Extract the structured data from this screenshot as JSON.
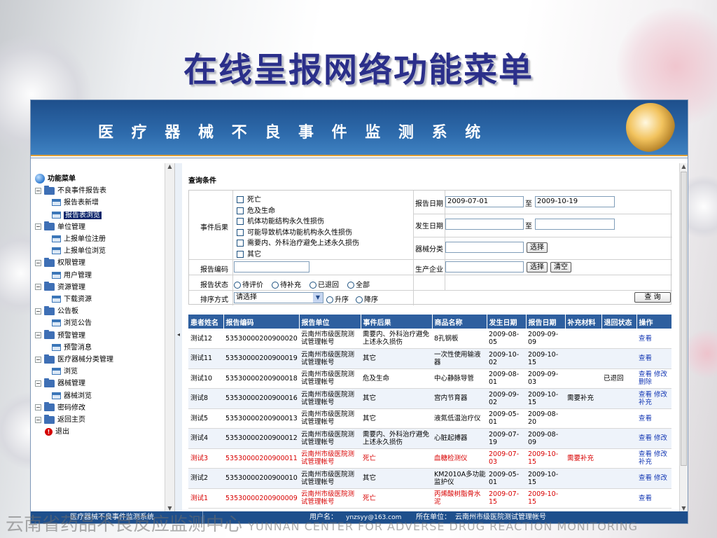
{
  "slide_title": "在线呈报网络功能菜单",
  "watermark": {
    "cn": "云南省药品不良反应监测中心",
    "en": "YUNNAN CENTER FOR ADVERSE DRUG REACTION MONITORING"
  },
  "banner_title": "医 疗 器 械 不 良 事 件 监 测 系 统",
  "tree": {
    "root": "功能菜单",
    "groups": [
      {
        "label": "不良事件报告表",
        "items": [
          "报告表新增",
          "报告表浏览"
        ]
      },
      {
        "label": "单位管理",
        "items": [
          "上报单位注册",
          "上报单位浏览"
        ]
      },
      {
        "label": "权限管理",
        "items": [
          "用户管理"
        ]
      },
      {
        "label": "资源管理",
        "items": [
          "下载资源"
        ]
      },
      {
        "label": "公告板",
        "items": [
          "浏览公告"
        ]
      },
      {
        "label": "预警管理",
        "items": [
          "预警消息"
        ]
      },
      {
        "label": "医疗器械分类管理",
        "items": [
          "浏览"
        ]
      },
      {
        "label": "器械管理",
        "items": [
          "器械浏览"
        ]
      },
      {
        "label": "密码修改",
        "items": []
      },
      {
        "label": "返回主页",
        "items": []
      }
    ],
    "exit": "退出",
    "selected": "报告表浏览",
    "expand_glyph": "−",
    "collapse_arrow": "◂",
    "scroll_up": "▲",
    "scroll_down": "▼"
  },
  "query": {
    "title": "查询条件",
    "event_result_label": "事件后果",
    "event_results": [
      "死亡",
      "危及生命",
      "机体功能结构永久性损伤",
      "可能导致机体功能机构永久性损伤",
      "需要内、外科治疗避免上述永久损伤",
      "其它"
    ],
    "report_code_label": "报告编码",
    "report_status_label": "报告状态",
    "report_statuses": [
      "待评价",
      "待补充",
      "已退回",
      "全部"
    ],
    "sort_label": "排序方式",
    "sort_value": "请选择",
    "sort_orders": [
      "升序",
      "降序"
    ],
    "report_date_label": "报告日期",
    "report_date_from": "2009-07-01",
    "report_date_to": "2009-10-19",
    "to_label": "至",
    "occur_date_label": "发生日期",
    "device_class_label": "器械分类",
    "manufacturer_label": "生产企业",
    "select_button": "选择",
    "clear_button": "清空",
    "search_button": "查 询",
    "dropdown_glyph": "▼"
  },
  "table": {
    "headers": [
      "患者姓名",
      "报告编码",
      "报告单位",
      "事件后果",
      "商品名称",
      "发生日期",
      "报告日期",
      "补充材料",
      "退回状态",
      "操作"
    ],
    "rows": [
      {
        "name": "测试12",
        "code": "53530000200900020",
        "unit": "云南州市级医院测试管理帐号",
        "result": "需要内、外科治疗避免上述永久损伤",
        "product": "8孔钢板",
        "occur": "2009-08-05",
        "report": "2009-09-09",
        "supp": "",
        "ret": "",
        "ops": "查看",
        "red": false
      },
      {
        "name": "测试11",
        "code": "53530000200900019",
        "unit": "云南州市级医院测试管理帐号",
        "result": "其它",
        "product": "一次性使用输液器",
        "occur": "2009-10-02",
        "report": "2009-10-15",
        "supp": "",
        "ret": "",
        "ops": "查看",
        "red": false
      },
      {
        "name": "测试10",
        "code": "53530000200900018",
        "unit": "云南州市级医院测试管理帐号",
        "result": "危及生命",
        "product": "中心静脉导管",
        "occur": "2009-08-01",
        "report": "2009-09-03",
        "supp": "",
        "ret": "已退回",
        "ops": "查看 修改 删除",
        "red": false
      },
      {
        "name": "测试8",
        "code": "53530000200900016",
        "unit": "云南州市级医院测试管理帐号",
        "result": "其它",
        "product": "宫内节育器",
        "occur": "2009-09-02",
        "report": "2009-10-15",
        "supp": "需要补充",
        "ret": "",
        "ops": "查看 修改 补充",
        "red": false
      },
      {
        "name": "测试5",
        "code": "53530000200900013",
        "unit": "云南州市级医院测试管理帐号",
        "result": "其它",
        "product": "液氮低温治疗仪",
        "occur": "2009-05-01",
        "report": "2009-08-20",
        "supp": "",
        "ret": "",
        "ops": "查看",
        "red": false
      },
      {
        "name": "测试4",
        "code": "53530000200900012",
        "unit": "云南州市级医院测试管理帐号",
        "result": "需要内、外科治疗避免上述永久损伤",
        "product": "心脏起搏器",
        "occur": "2009-07-19",
        "report": "2009-08-09",
        "supp": "",
        "ret": "",
        "ops": "查看 修改",
        "red": false
      },
      {
        "name": "测试3",
        "code": "53530000200900011",
        "unit": "云南州市级医院测试管理帐号",
        "result": "死亡",
        "product": "血糖检测仪",
        "occur": "2009-07-03",
        "report": "2009-10-15",
        "supp": "需要补充",
        "ret": "",
        "ops": "查看 修改 补充",
        "red": true
      },
      {
        "name": "测试2",
        "code": "53530000200900010",
        "unit": "云南州市级医院测试管理帐号",
        "result": "其它",
        "product": "KM2010A多功能监护仪",
        "occur": "2009-05-01",
        "report": "2009-10-15",
        "supp": "",
        "ret": "",
        "ops": "查看 修改",
        "red": false
      },
      {
        "name": "测试1",
        "code": "53530000200900009",
        "unit": "云南州市级医院测试管理帐号",
        "result": "死亡",
        "product": "丙烯酸树脂骨水泥",
        "occur": "2009-07-15",
        "report": "2009-10-15",
        "supp": "",
        "ret": "",
        "ops": "查看",
        "red": true
      }
    ]
  },
  "status_bar": {
    "system": "医疗器械不良事件监测系统",
    "user_label": "用户名：",
    "user": "ynzsyy@163.com",
    "unit_label": "所在单位：",
    "unit": "云南州市级医院测试管理帐号"
  }
}
